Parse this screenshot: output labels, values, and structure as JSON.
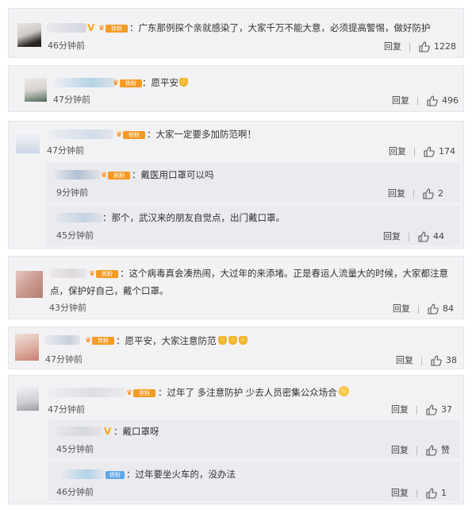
{
  "badge": {
    "fan_label": "铁粉"
  },
  "actions": {
    "reply": "回复"
  },
  "comments": [
    {
      "text": "：广东那例探个亲就感染了，大家千万不能大意，必须提高警惕，做好防护",
      "time": "46分钟前",
      "likes": "1228"
    },
    {
      "text": "：愿平安",
      "time": "47分钟前",
      "likes": "496"
    },
    {
      "text": "：大家一定要多加防范啊！",
      "time": "47分钟前",
      "likes": "174",
      "replies": [
        {
          "text": "：戴医用口罩可以吗",
          "time": "9分钟前",
          "likes": "2"
        },
        {
          "text": "：那个，武汉来的朋友自觉点，出门戴口罩。",
          "time": "45分钟前",
          "likes": "44"
        }
      ]
    },
    {
      "text_line1": "：这个病毒真会凑热闹，大过年的来添堵。正是春运人流量大的时候，大家都注意",
      "text_line2": "点，保护好自己，戴个口罩。",
      "time": "43分钟前",
      "likes": "84"
    },
    {
      "text": "：愿平安，大家注意防范",
      "time": "47分钟前",
      "likes": "38"
    },
    {
      "text": "：过年了 多注意防护 少去人员密集公众场合",
      "time": "47分钟前",
      "likes": "37",
      "replies": [
        {
          "text": "：戴口罩呀",
          "time": "45分钟前",
          "likes": "赞"
        },
        {
          "text": "：过年要坐火车的，没办法",
          "time": "46分钟前",
          "likes": "1"
        }
      ]
    }
  ],
  "colors": {
    "crown": "#ff8200",
    "fan_tag": "#f59a23",
    "fan_tag_blue": "#5ca7e8",
    "vip": "#f5a623"
  }
}
